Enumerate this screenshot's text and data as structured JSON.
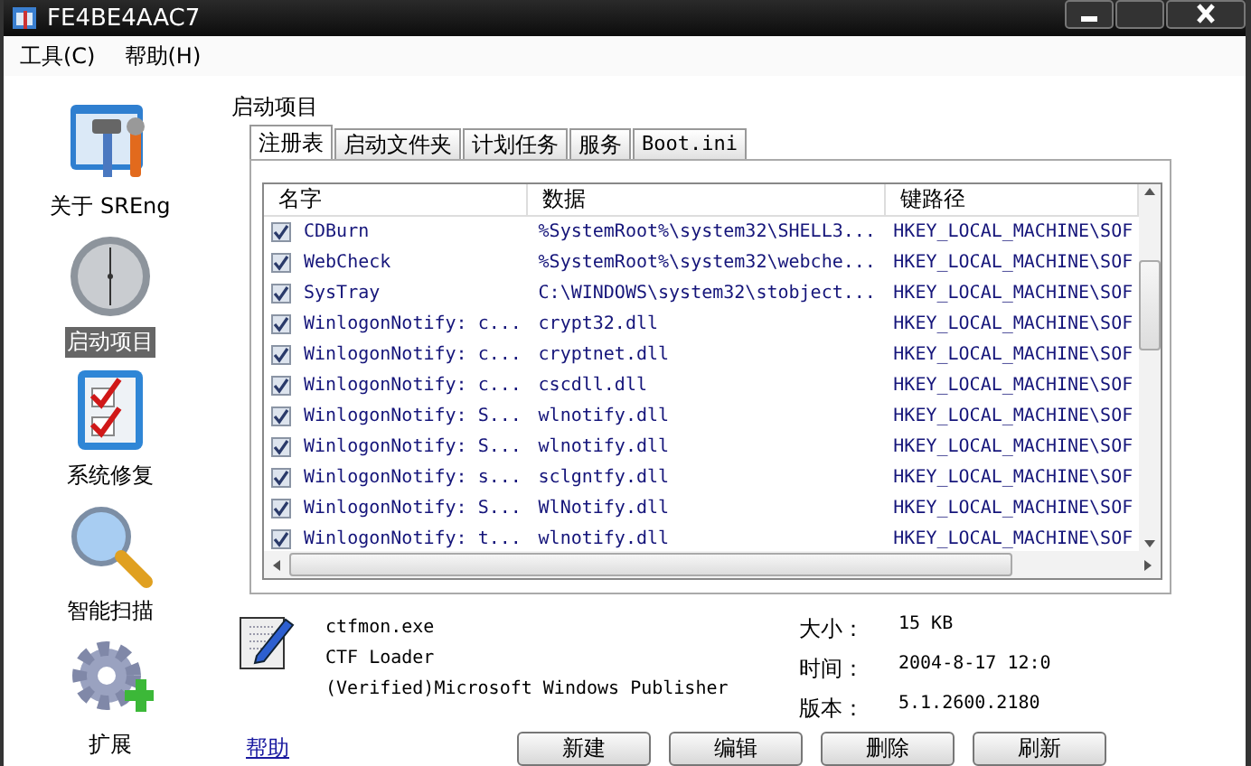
{
  "window": {
    "title": "FE4BE4AAC7"
  },
  "menu": [
    {
      "label": "工具(C)"
    },
    {
      "label": "帮助(H)"
    }
  ],
  "sidebar": {
    "items": [
      {
        "label": "关于 SREng",
        "kind": "about",
        "selected": false
      },
      {
        "label": "启动项目",
        "kind": "clock",
        "selected": true
      },
      {
        "label": "系统修复",
        "kind": "repair",
        "selected": false
      },
      {
        "label": "智能扫描",
        "kind": "scan",
        "selected": false
      },
      {
        "label": "扩展",
        "kind": "extend",
        "selected": false
      }
    ]
  },
  "section_title": "启动项目",
  "tabs": [
    {
      "label": "注册表",
      "selected": true
    },
    {
      "label": "启动文件夹",
      "selected": false
    },
    {
      "label": "计划任务",
      "selected": false
    },
    {
      "label": "服务",
      "selected": false
    },
    {
      "label": "Boot.ini",
      "selected": false
    }
  ],
  "table": {
    "columns": [
      "名字",
      "数据",
      "键路径"
    ],
    "rows": [
      {
        "checked": true,
        "name": "CDBurn",
        "data": "%SystemRoot%\\system32\\SHELL3...",
        "key": "HKEY_LOCAL_MACHINE\\SOF"
      },
      {
        "checked": true,
        "name": "WebCheck",
        "data": "%SystemRoot%\\system32\\webche...",
        "key": "HKEY_LOCAL_MACHINE\\SOF"
      },
      {
        "checked": true,
        "name": "SysTray",
        "data": "C:\\WINDOWS\\system32\\stobject...",
        "key": "HKEY_LOCAL_MACHINE\\SOF"
      },
      {
        "checked": true,
        "name": "WinlogonNotify: c...",
        "data": "crypt32.dll",
        "key": "HKEY_LOCAL_MACHINE\\SOF"
      },
      {
        "checked": true,
        "name": "WinlogonNotify: c...",
        "data": "cryptnet.dll",
        "key": "HKEY_LOCAL_MACHINE\\SOF"
      },
      {
        "checked": true,
        "name": "WinlogonNotify: c...",
        "data": "cscdll.dll",
        "key": "HKEY_LOCAL_MACHINE\\SOF"
      },
      {
        "checked": true,
        "name": "WinlogonNotify: S...",
        "data": "wlnotify.dll",
        "key": "HKEY_LOCAL_MACHINE\\SOF"
      },
      {
        "checked": true,
        "name": "WinlogonNotify: S...",
        "data": "wlnotify.dll",
        "key": "HKEY_LOCAL_MACHINE\\SOF"
      },
      {
        "checked": true,
        "name": "WinlogonNotify: s...",
        "data": "sclgntfy.dll",
        "key": "HKEY_LOCAL_MACHINE\\SOF"
      },
      {
        "checked": true,
        "name": "WinlogonNotify: S...",
        "data": "WlNotify.dll",
        "key": "HKEY_LOCAL_MACHINE\\SOF"
      },
      {
        "checked": true,
        "name": "WinlogonNotify: t...",
        "data": "wlnotify.dll",
        "key": "HKEY_LOCAL_MACHINE\\SOF"
      }
    ]
  },
  "details": {
    "file": "ctfmon.exe",
    "description": "CTF Loader",
    "publisher": "(Verified)Microsoft Windows Publisher",
    "fields": [
      {
        "label": "大小：",
        "value": "15 KB"
      },
      {
        "label": "时间：",
        "value": "2004-8-17 12:0"
      },
      {
        "label": "版本：",
        "value": "5.1.2600.2180"
      }
    ]
  },
  "help_link": "帮助",
  "buttons": [
    "新建",
    "编辑",
    "删除",
    "刷新"
  ]
}
